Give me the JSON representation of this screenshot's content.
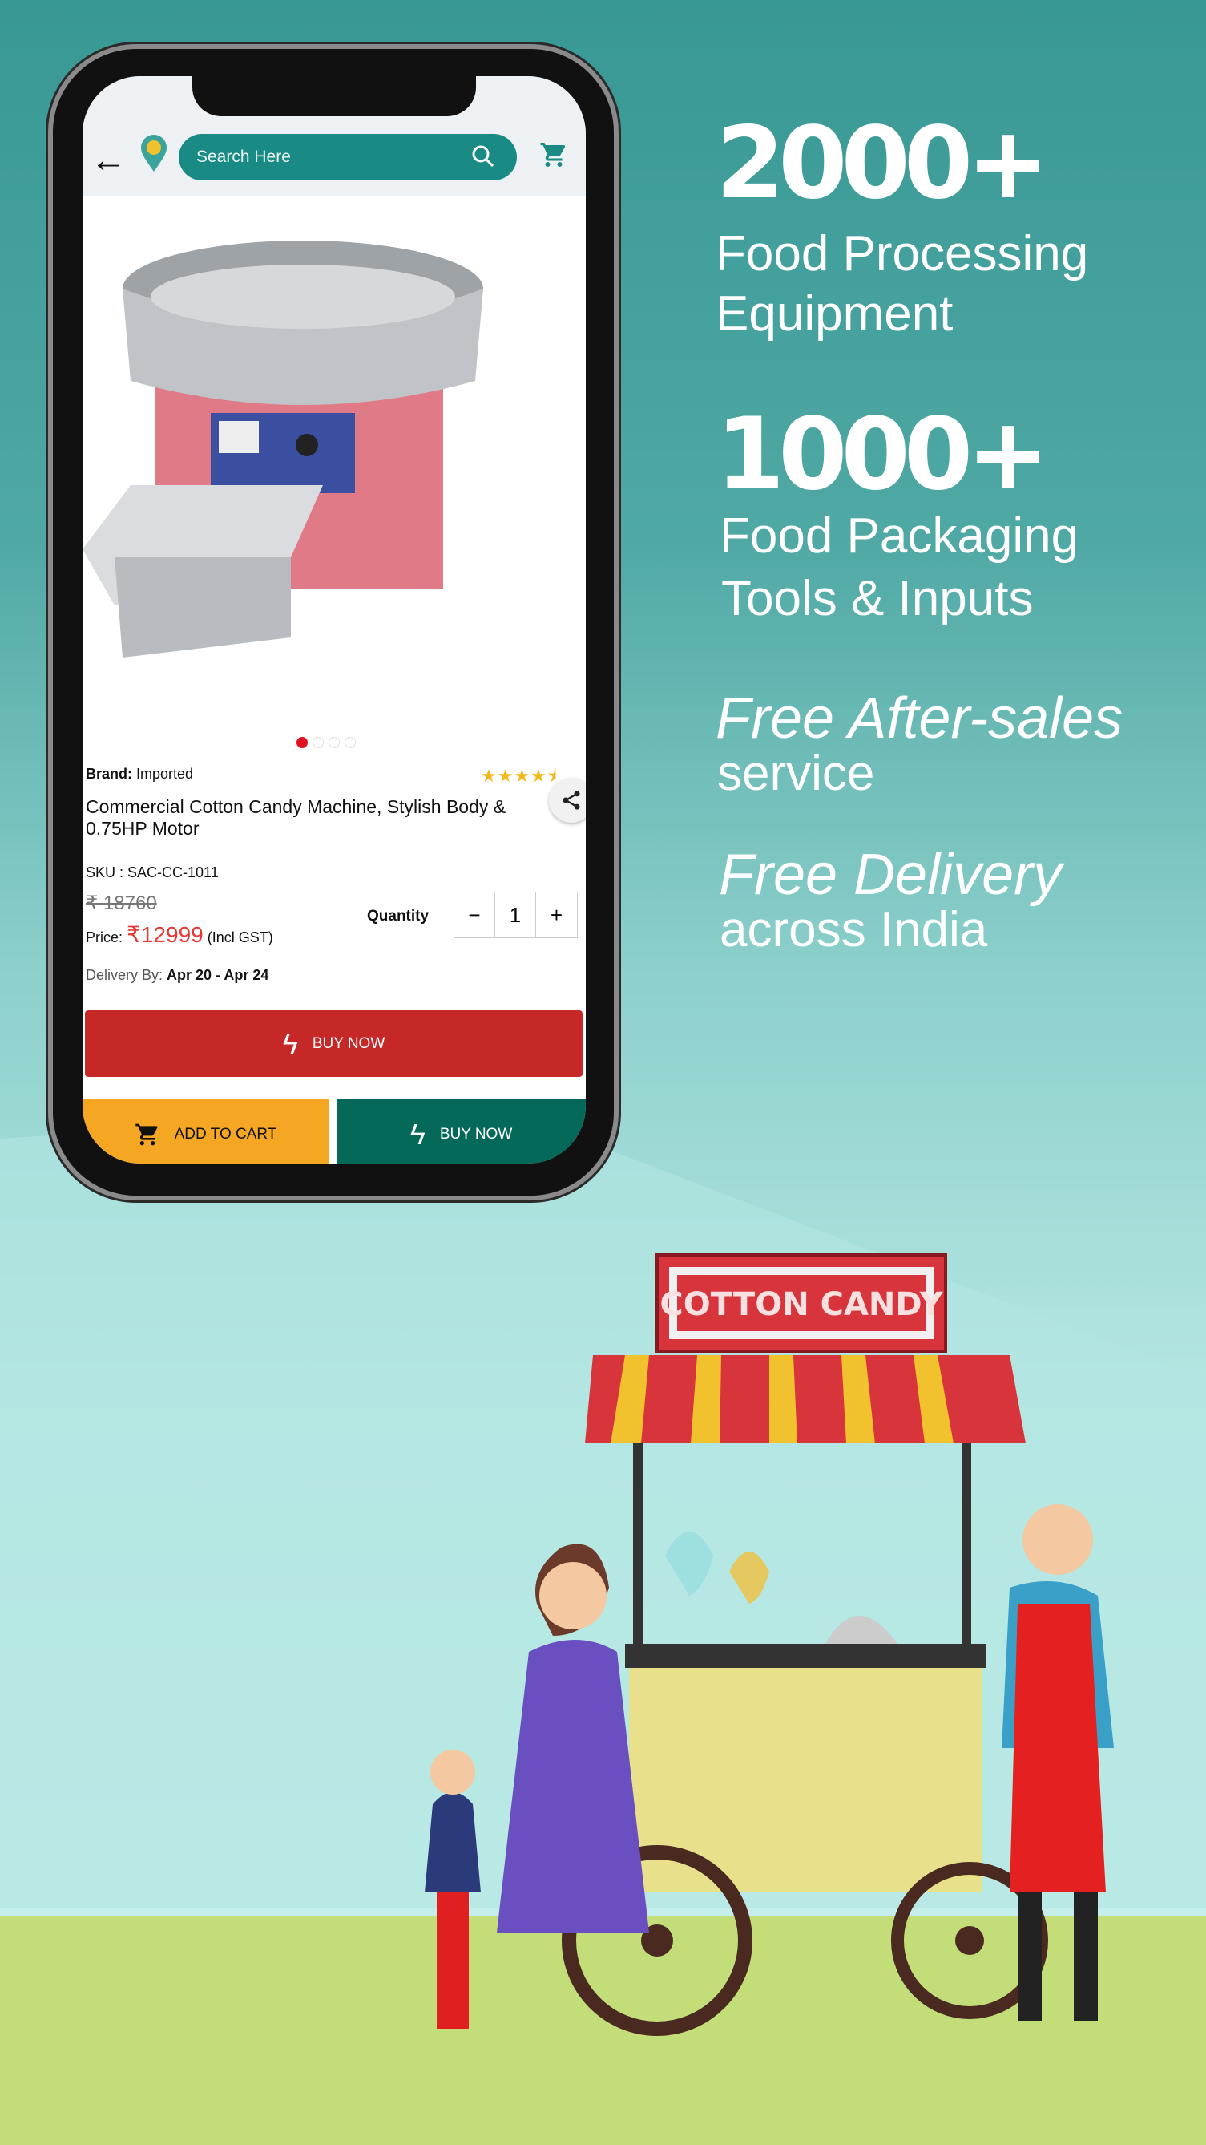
{
  "header": {
    "search_placeholder": "Search Here",
    "icons": [
      "back-arrow-icon",
      "location-pin-icon",
      "search-icon",
      "cart-icon"
    ]
  },
  "product": {
    "carousel": {
      "total": 4,
      "active": 1
    },
    "brand_label": "Brand:",
    "brand": "Imported",
    "rating": 4.5,
    "title": "Commercial Cotton Candy Machine, Stylish Body & 0.75HP Motor",
    "sku": "SKU : SAC-CC-1011",
    "mrp": "₹ 18760",
    "price_label": "Price:",
    "price": "₹12999",
    "price_note": "(Incl GST)",
    "quantity_label": "Quantity",
    "quantity": "1",
    "minus": "−",
    "plus": "+",
    "delivery_label": "Delivery By:",
    "delivery": "Apr 20 - Apr 24"
  },
  "buttons": {
    "buy_now": "BUY NOW",
    "add_to_cart": "ADD TO CART",
    "buy_now_bottom": "BUY NOW"
  },
  "colors": {
    "teal": "#1a8a85",
    "red": "#c62828",
    "amber": "#f5a623",
    "dark_green": "#05695a",
    "price_red": "#e53935"
  },
  "promo": {
    "stat1": "2000+",
    "stat1_l1": "Food Processing",
    "stat1_l2": "Equipment",
    "stat2": "1000+",
    "stat2_l1": "Food Packaging",
    "stat2_l2": "Tools & Inputs",
    "f1": "Free After-sales",
    "f1_sub": "service",
    "f2": "Free Delivery",
    "f2_sub": "across India"
  },
  "illustration": {
    "sign": "COTTON CANDY"
  }
}
